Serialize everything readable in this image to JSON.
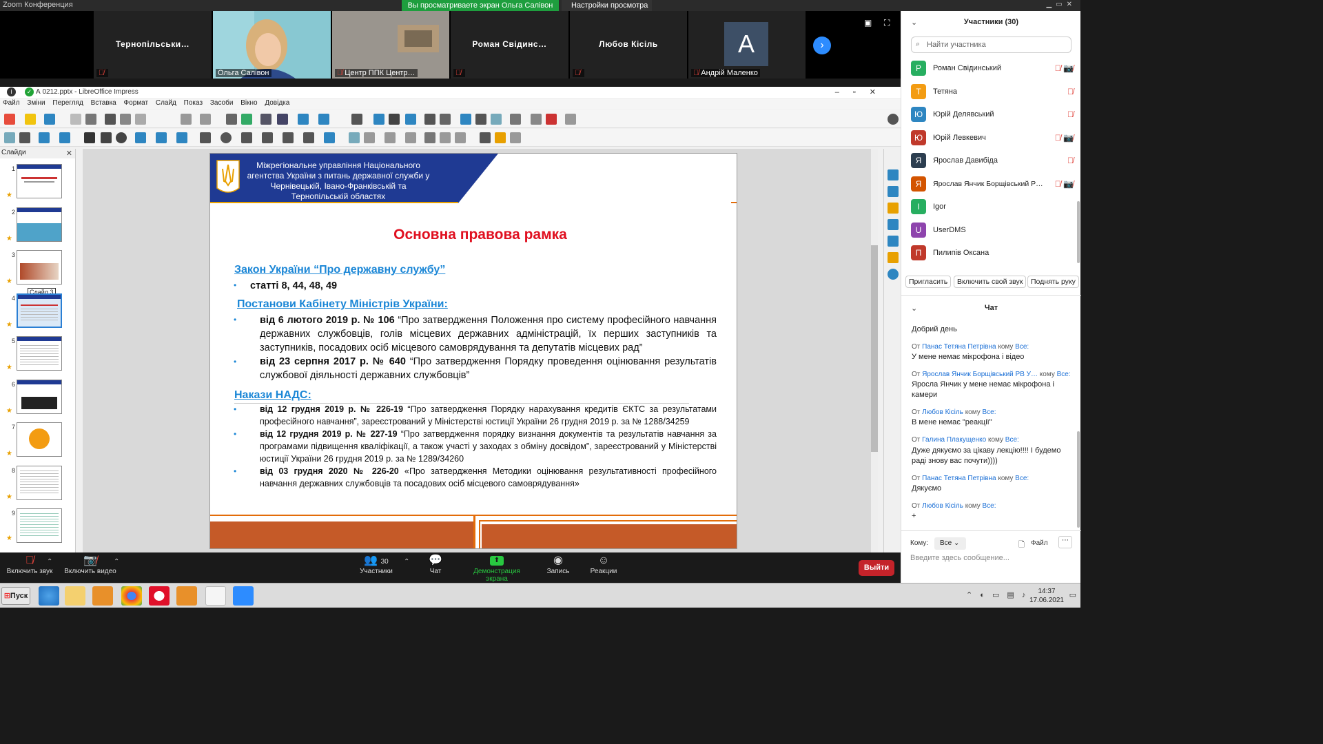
{
  "zoom": {
    "window_title": "Zoom Конференция",
    "share_banner": "Вы просматриваете экран Ольга Салівон",
    "view_options": "Настройки просмотра ⌄",
    "video_tiles": [
      {
        "name": "Тернопільськи…",
        "label": ""
      },
      {
        "name": "",
        "label": "Ольга Салівон"
      },
      {
        "name": "",
        "label": "Центр ППК Центр…"
      },
      {
        "name": "Роман   Свідинс…",
        "label": ""
      },
      {
        "name": "Любов Кісіль",
        "label": ""
      },
      {
        "name": "",
        "label": "Андрій Маленко",
        "avatar_letter": "A"
      }
    ]
  },
  "impress": {
    "title": "А 0212.pptx - LibreOffice Impress",
    "menu": [
      "Файл",
      "Зміни",
      "Перегляд",
      "Вставка",
      "Формат",
      "Слайд",
      "Показ",
      "Засоби",
      "Вікно",
      "Довідка"
    ],
    "slides_header": "Слайди",
    "slide_tooltip": "Слайд 3",
    "slide_numbers": [
      "1",
      "2",
      "3",
      "4",
      "5",
      "6",
      "7",
      "8",
      "9"
    ]
  },
  "slide": {
    "org": "Міжрегіональне управління Національного агентства України з питань державної служби  у Чернівецькій, Івано-Франківській та Тернопільській областях",
    "title": "Основна правова рамка",
    "law_heading": "Закон України “Про державну службу”",
    "law_item": "статті 8, 44, 48, 49",
    "cm_heading": "Постанови  Кабінету Міністрів України:",
    "cm_items": [
      {
        "bold": "від 6 лютого 2019 р. № 106",
        "rest": " “Про затвердження Положення про систему професійного навчання державних службовців, голів місцевих державних адміністрацій, їх перших заступників та заступників, посадових осіб місцевого самоврядування та депутатів місцевих рад”"
      },
      {
        "bold": "від 23 серпня 2017 р. № 640",
        "rest": " “Про затвердження Порядку проведення оцінювання результатів службової діяльності державних службовців”"
      }
    ],
    "nads_heading": "Накази НАДС:",
    "nads_items": [
      {
        "bold": "від 12 грудня 2019 р. № 226-19",
        "rest": " “Про затвердження Порядку нарахування кредитів ЄКТС за результатами професійного навчання”, зареєстрований у Міністерстві юстиції України 26 грудня 2019 р. за № 1288/34259"
      },
      {
        "bold": "від 12 грудня 2019 р. № 227-19",
        "rest": " “Про затвердження порядку визнання документів та результатів навчання за програмами підвищення кваліфікації, а також участі у заходах з обміну досвідом”, зареєстрований у Міністерстві юстиції України 26 грудня 2019 р. за № 1289/34260"
      },
      {
        "bold": "від 03 грудня 2020  № 226-20",
        "rest": " «Про затвердження Методики оцінювання результативності професійного навчання державних службовців та посадових осіб місцевого самоврядування»"
      }
    ]
  },
  "participants": {
    "header": "Участники (30)",
    "search_placeholder": "Найти участника",
    "list": [
      {
        "letter": "Р",
        "name": "Роман  Свідинський",
        "color": "#27ae60"
      },
      {
        "letter": "Т",
        "name": "Тетяна",
        "color": "#f39c12"
      },
      {
        "letter": "Ю",
        "name": "Юрій Делявський",
        "color": "#2e86c1"
      },
      {
        "letter": "Ю",
        "name": "Юрій Левкевич",
        "color": "#c0392b"
      },
      {
        "letter": "Я",
        "name": "Ярослав Давибіда",
        "color": "#2c3e50"
      },
      {
        "letter": "Я",
        "name": "Ярослав Янчик Борщівський Р…",
        "color": "#d35400"
      },
      {
        "letter": "I",
        "name": "Igor",
        "color": "#27ae60"
      },
      {
        "letter": "U",
        "name": "UserDMS",
        "color": "#8e44ad"
      },
      {
        "letter": "П",
        "name": "Пилипів Оксана",
        "color": "#c0392b"
      }
    ],
    "buttons": [
      "Пригласить",
      "Включить свой звук",
      "Поднять руку"
    ]
  },
  "chat": {
    "header": "Чат",
    "messages": [
      {
        "from": "",
        "text": "Добрий день"
      },
      {
        "from": "Панас Тетяна Петрівна",
        "text": "У мене немає мікрофона і відео"
      },
      {
        "from": "Ярослав Янчик Борщівський РВ У…",
        "text": "Яросла Янчик у мене немає мікрофона і камери"
      },
      {
        "from": "Любов Кісіль",
        "text": "В мене немає \"реакції\""
      },
      {
        "from": "Галина Плакущенко",
        "text": "Дуже дякуємо за цікаву лекцію!!!! І будемо раді знову вас почути))))"
      },
      {
        "from": "Панас Тетяна Петрівна",
        "text": "Дякуємо"
      },
      {
        "from": "Любов Кісіль",
        "text": "+"
      }
    ],
    "from_prefix": "От",
    "to_text": "кому",
    "to_all": "Все:",
    "to_label": "Кому:",
    "to_value": "Все",
    "file_label": "Файл",
    "input_placeholder": "Введите здесь сообщение..."
  },
  "controls": {
    "mute": "Включить звук",
    "video": "Включить видео",
    "participants": "Участники",
    "participants_count": "30",
    "chat": "Чат",
    "share": "Демонстрация экрана",
    "record": "Запись",
    "reactions": "Реакции",
    "leave": "Выйти"
  },
  "taskbar": {
    "start": "Пуск",
    "time": "14:37",
    "date": "17.06.2021"
  }
}
